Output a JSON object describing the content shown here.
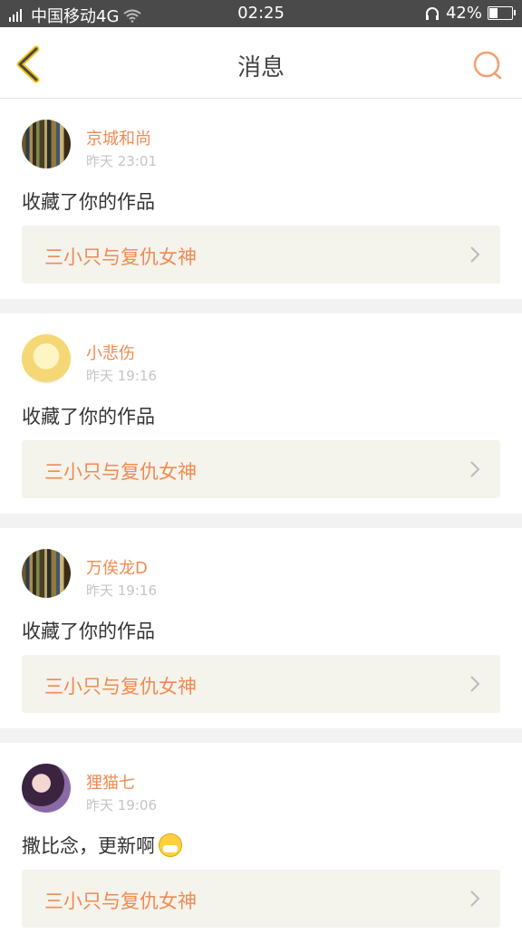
{
  "status_bar": {
    "carrier": "中国移动4G",
    "time": "02:25",
    "battery": "42%",
    "battery_level": 0.42
  },
  "nav": {
    "title": "消息"
  },
  "messages": [
    {
      "user": "京城和尚",
      "time": "昨天 23:01",
      "text": "收藏了你的作品",
      "work": "三小只与复仇女神"
    },
    {
      "user": "小悲伤",
      "time": "昨天 19:16",
      "text": "收藏了你的作品",
      "work": "三小只与复仇女神"
    },
    {
      "user": "万俟龙D",
      "time": "昨天 19:16",
      "text": "收藏了你的作品",
      "work": "三小只与复仇女神"
    },
    {
      "user": "狸猫七",
      "time": "昨天 19:06",
      "text": "撒比念，更新啊",
      "work": "三小只与复仇女神"
    }
  ],
  "colors": {
    "accent": "#f08b52",
    "statusbar": "#4a4a4a",
    "card_bg": "#f4f3ec"
  },
  "icons": [
    "signal-icon",
    "wifi-icon",
    "headset-icon",
    "battery-icon",
    "back-icon",
    "search-icon",
    "chevron-right-icon",
    "mask-emoji-icon"
  ]
}
